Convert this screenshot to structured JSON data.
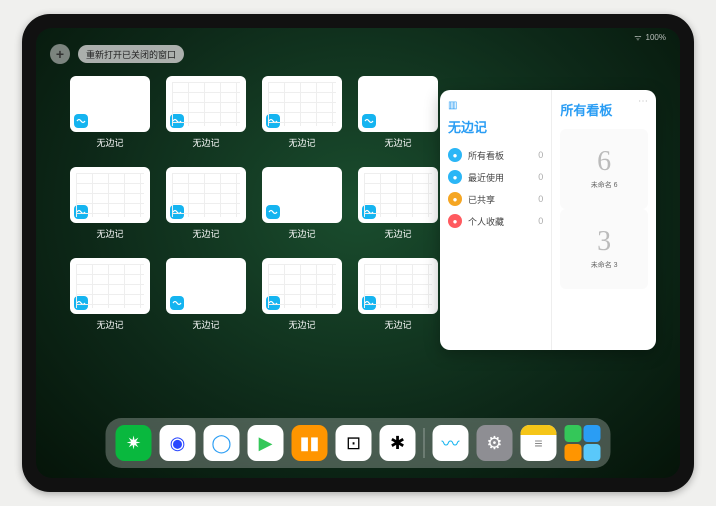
{
  "status": {
    "wifi": "wifi-icon",
    "battery": "100%"
  },
  "topbar": {
    "plus_label": "+",
    "reopen_label": "重新打开已关闭的窗口"
  },
  "thumbnails": {
    "app_name": "无边记",
    "items": [
      {
        "label": "无边记",
        "preview": "blank"
      },
      {
        "label": "无边记",
        "preview": "grid"
      },
      {
        "label": "无边记",
        "preview": "grid"
      },
      {
        "label": "无边记",
        "preview": "blank"
      },
      {
        "label": "无边记",
        "preview": "grid"
      },
      {
        "label": "无边记",
        "preview": "grid"
      },
      {
        "label": "无边记",
        "preview": "blank"
      },
      {
        "label": "无边记",
        "preview": "grid"
      },
      {
        "label": "无边记",
        "preview": "grid"
      },
      {
        "label": "无边记",
        "preview": "blank"
      },
      {
        "label": "无边记",
        "preview": "grid"
      },
      {
        "label": "无边记",
        "preview": "grid"
      }
    ]
  },
  "panel": {
    "left_title": "无边记",
    "right_title": "所有看板",
    "menu": [
      {
        "icon_color": "#2bb6f6",
        "label": "所有看板",
        "count": "0"
      },
      {
        "icon_color": "#2bb6f6",
        "label": "最近使用",
        "count": "0"
      },
      {
        "icon_color": "#f5a623",
        "label": "已共享",
        "count": "0"
      },
      {
        "icon_color": "#ff5a5f",
        "label": "个人收藏",
        "count": "0"
      }
    ],
    "boards": [
      {
        "glyph": "6",
        "name": "未命名 6",
        "sub": ""
      },
      {
        "glyph": "3",
        "name": "未命名 3",
        "sub": ""
      }
    ]
  },
  "dock": {
    "apps": [
      {
        "name": "wechat",
        "bg": "#09b83e",
        "glyph": "✷"
      },
      {
        "name": "quark",
        "bg": "#ffffff",
        "glyph": "◉",
        "fg": "#2946ff"
      },
      {
        "name": "qqbrowser",
        "bg": "#ffffff",
        "glyph": "◯",
        "fg": "#2a9df4"
      },
      {
        "name": "play",
        "bg": "#ffffff",
        "glyph": "▶",
        "fg": "#34c759"
      },
      {
        "name": "books",
        "bg": "#ff9500",
        "glyph": "▮▮"
      },
      {
        "name": "dice",
        "bg": "#ffffff",
        "glyph": "⊡",
        "fg": "#000"
      },
      {
        "name": "connect",
        "bg": "#ffffff",
        "glyph": "✱",
        "fg": "#000"
      }
    ],
    "recent": [
      {
        "name": "freeform",
        "bg": "#ffffff",
        "glyph": "〰",
        "fg": "#15b4f0"
      },
      {
        "name": "settings",
        "bg": "#8e8e93",
        "glyph": "⚙"
      },
      {
        "name": "notes",
        "bg": "#ffffff",
        "glyph": "≡",
        "fg": "#f5c518",
        "topbar": true
      }
    ]
  }
}
